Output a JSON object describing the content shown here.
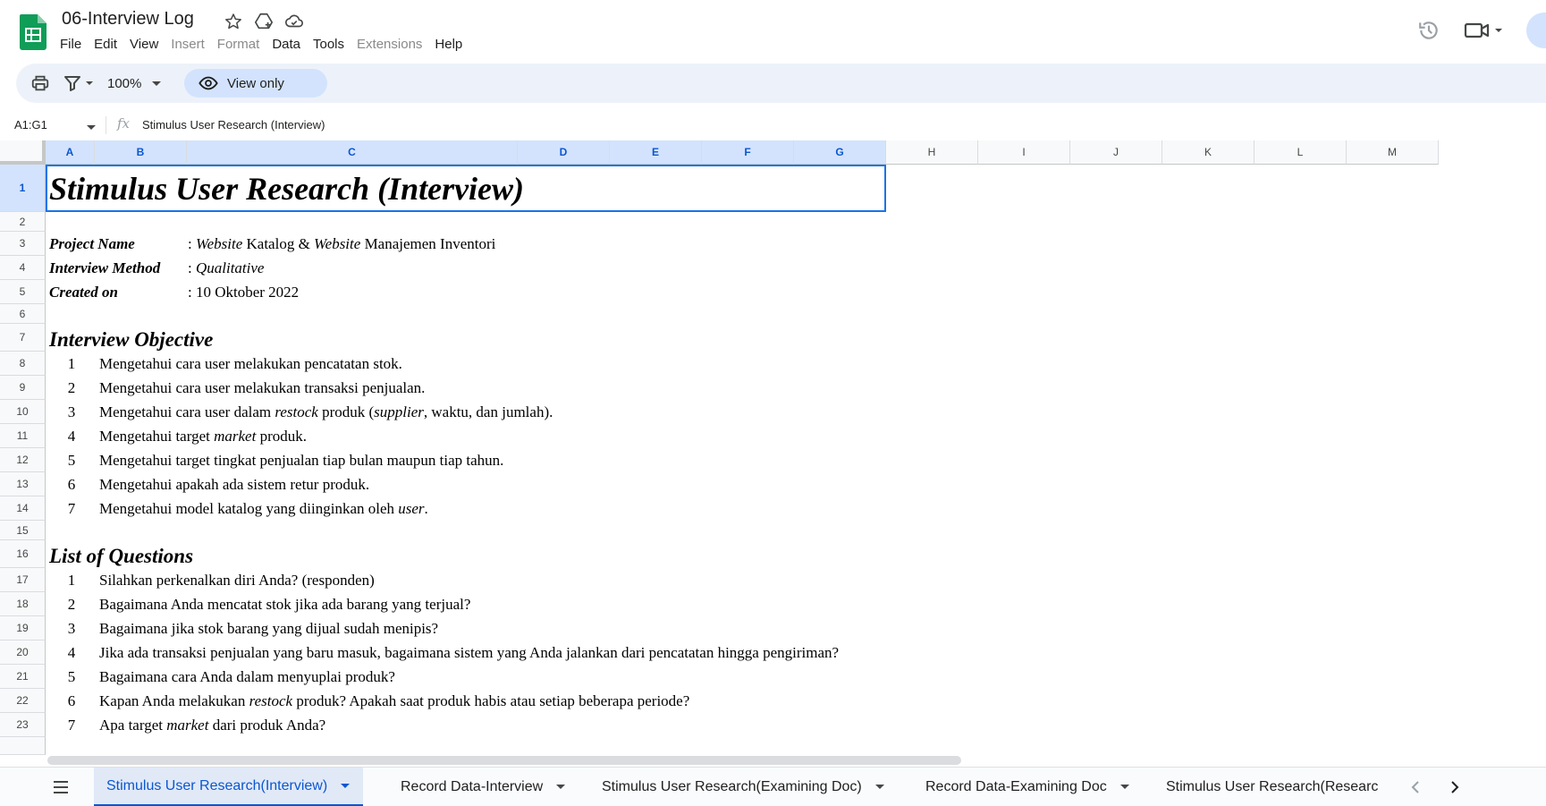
{
  "app": {
    "doc_title": "06-Interview Log",
    "menu": [
      {
        "label": "File",
        "enabled": true
      },
      {
        "label": "Edit",
        "enabled": true
      },
      {
        "label": "View",
        "enabled": true
      },
      {
        "label": "Insert",
        "enabled": false
      },
      {
        "label": "Format",
        "enabled": false
      },
      {
        "label": "Data",
        "enabled": true
      },
      {
        "label": "Tools",
        "enabled": true
      },
      {
        "label": "Extensions",
        "enabled": false
      },
      {
        "label": "Help",
        "enabled": true
      }
    ],
    "icons": [
      "sheets-logo-icon",
      "star-icon",
      "move-to-drive-icon",
      "cloud-status-icon",
      "version-history-icon",
      "meet-video-icon"
    ]
  },
  "toolbar": {
    "zoom": "100%",
    "view_only_label": "View only"
  },
  "formula_bar": {
    "name_box": "A1:G1",
    "content": "Stimulus User Research (Interview)"
  },
  "grid": {
    "columns": [
      "A",
      "B",
      "C",
      "D",
      "E",
      "F",
      "G",
      "H",
      "I",
      "J",
      "K",
      "L",
      "M"
    ],
    "selected_columns": [
      "A",
      "B",
      "C",
      "D",
      "E",
      "F",
      "G"
    ],
    "rows": [
      "1",
      "2",
      "3",
      "4",
      "5",
      "6",
      "7",
      "8",
      "9",
      "10",
      "11",
      "12",
      "13",
      "14",
      "15",
      "16",
      "17",
      "18",
      "19",
      "20",
      "21",
      "22",
      "23"
    ],
    "selected_row": "1"
  },
  "sheet": {
    "title": "Stimulus User Research (Interview)",
    "meta": [
      {
        "label": "Project Name",
        "value_parts": [
          ": ",
          {
            "i": "Website"
          },
          " Katalog & ",
          {
            "i": "Website"
          },
          " Manajemen Inventori"
        ]
      },
      {
        "label": "Interview Method",
        "value_parts": [
          ": ",
          {
            "i": "Qualitative"
          }
        ]
      },
      {
        "label": "Created on",
        "value_parts": [
          ": 10 Oktober 2022"
        ]
      }
    ],
    "objective_title": "Interview Objective",
    "objectives": [
      {
        "n": "1",
        "parts": [
          "Mengetahui cara user melakukan pencatatan stok."
        ]
      },
      {
        "n": "2",
        "parts": [
          "Mengetahui cara user melakukan transaksi penjualan."
        ]
      },
      {
        "n": "3",
        "parts": [
          "Mengetahui cara user dalam ",
          {
            "i": "restock"
          },
          " produk (",
          {
            "i": "supplier"
          },
          ", waktu, dan jumlah)."
        ]
      },
      {
        "n": "4",
        "parts": [
          "Mengetahui target ",
          {
            "i": "market"
          },
          " produk."
        ]
      },
      {
        "n": "5",
        "parts": [
          "Mengetahui target tingkat penjualan tiap bulan maupun tiap tahun."
        ]
      },
      {
        "n": "6",
        "parts": [
          "Mengetahui apakah ada sistem retur produk."
        ]
      },
      {
        "n": "7",
        "parts": [
          "Mengetahui model katalog yang diinginkan oleh ",
          {
            "i": "user"
          },
          "."
        ]
      }
    ],
    "questions_title": "List of Questions",
    "questions": [
      {
        "n": "1",
        "parts": [
          "Silahkan perkenalkan diri Anda? (responden)"
        ]
      },
      {
        "n": "2",
        "parts": [
          "Bagaimana Anda mencatat stok jika ada barang yang terjual?"
        ]
      },
      {
        "n": "3",
        "parts": [
          "Bagaimana jika stok barang yang dijual sudah menipis?"
        ]
      },
      {
        "n": "4",
        "parts": [
          "Jika ada transaksi penjualan yang baru masuk, bagaimana sistem yang Anda jalankan dari pencatatan hingga pengiriman?"
        ]
      },
      {
        "n": "5",
        "parts": [
          "Bagaimana cara Anda dalam menyuplai produk?"
        ]
      },
      {
        "n": "6",
        "parts": [
          "Kapan Anda melakukan ",
          {
            "i": "restock"
          },
          " produk? Apakah saat produk habis atau setiap beberapa periode?"
        ]
      },
      {
        "n": "7",
        "parts": [
          "Apa target ",
          {
            "i": "market"
          },
          " dari produk Anda?"
        ]
      }
    ]
  },
  "tabs": [
    {
      "label": "Stimulus User Research(Interview)",
      "active": true
    },
    {
      "label": "Record Data-Interview",
      "active": false
    },
    {
      "label": "Stimulus User Research(Examining Doc)",
      "active": false
    },
    {
      "label": "Record Data-Examining Doc",
      "active": false
    },
    {
      "label": "Stimulus User Research(Researc",
      "active": false
    }
  ],
  "colors": {
    "accent": "#0b57d0",
    "selection": "#1a73e8",
    "toolbar_bg": "#edf2fa",
    "selected_header_bg": "#d3e3fd",
    "sheets_green": "#0f9d58"
  }
}
